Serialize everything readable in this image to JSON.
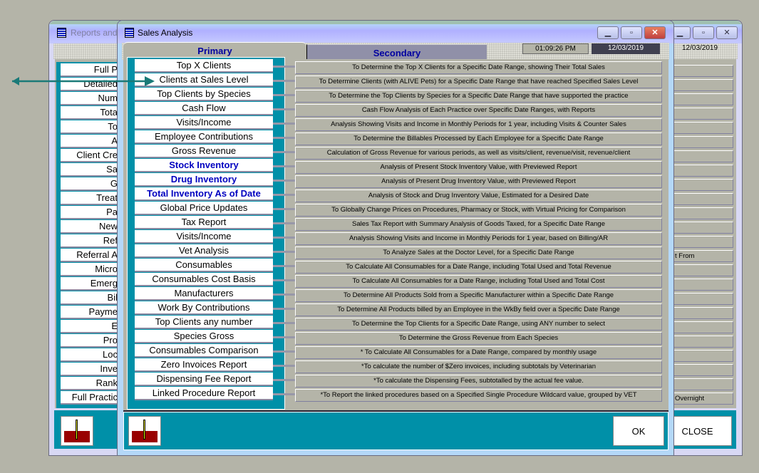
{
  "background_window": {
    "title": "Reports and",
    "date": "12/03/2019",
    "left_items": [
      "Full P",
      "Detailed",
      "Num",
      "Tota",
      "To",
      "A",
      "Client Cre",
      "Sa",
      "G",
      "Treat",
      "Pa",
      "New",
      "Ref",
      "Referral A",
      "Micro",
      "Emerg",
      "Bil",
      "Payme",
      "E",
      "Pro",
      "Loc",
      "Inve",
      "Rank",
      "Full Practic"
    ],
    "right_items": [
      "",
      "",
      "",
      "",
      "",
      "",
      "",
      "",
      "",
      "",
      "",
      "",
      "",
      "t From",
      "",
      "",
      "",
      "",
      "",
      "",
      "",
      "",
      "",
      "Overnight"
    ],
    "close_label": "CLOSE"
  },
  "dialog": {
    "title": "Sales Analysis",
    "tabs": [
      {
        "label": "Primary",
        "active": true
      },
      {
        "label": "Secondary",
        "active": false
      }
    ],
    "time": "01:09:26 PM",
    "date": "12/03/2019",
    "ok_label": "OK",
    "reports": [
      {
        "label": "Top X Clients",
        "desc": "To Determine the Top X Clients for a Specific Date Range, showing Their Total Sales"
      },
      {
        "label": "Clients at Sales Level",
        "desc": "To Determine Clients (with ALIVE Pets) for a Specific Date Range that have reached Specified Sales Level"
      },
      {
        "label": "Top Clients by Species",
        "desc": "To Determine the Top Clients by Species for a Specific Date Range that have supported the practice"
      },
      {
        "label": "Cash Flow",
        "desc": "Cash Flow Analysis of Each Practice over Specific Date Ranges, with Reports"
      },
      {
        "label": "Visits/Income",
        "desc": "Analysis Showing Visits and Income in Monthly Periods for 1 year, including Visits & Counter Sales"
      },
      {
        "label": "Employee Contributions",
        "desc": "To Determine the Billables Processed by Each Employee for a Specific Date Range"
      },
      {
        "label": "Gross Revenue",
        "desc": "Calculation of Gross Revenue for various periods, as well as visits/client, revenue/visit, revenue/client"
      },
      {
        "label": "Stock Inventory",
        "desc": "Analysis of Present Stock Inventory Value, with Previewed Report",
        "bold": true
      },
      {
        "label": "Drug Inventory",
        "desc": "Analysis of Present Drug Inventory Value, with Previewed Report",
        "bold": true
      },
      {
        "label": "Total Inventory As of Date",
        "desc": "Analysis of Stock and Drug Inventory Value, Estimated for a Desired Date",
        "bold": true
      },
      {
        "label": "Global Price Updates",
        "desc": "To Globally Change Prices on Procedures, Pharmacy or Stock, with Virtual Pricing for Comparison"
      },
      {
        "label": "Tax Report",
        "desc": "Sales Tax Report with Summary Analysis of Goods Taxed, for a Specific Date Range"
      },
      {
        "label": "Visits/Income",
        "desc": "Analysis Showing Visits and Income in Monthly Periods for 1 year, based on Billing/AR"
      },
      {
        "label": "Vet Analysis",
        "desc": "To Analyze Sales at the Doctor Level, for a Specific Date Range"
      },
      {
        "label": "Consumables",
        "desc": "To Calculate All Consumables for a Date Range, including Total Used and Total Revenue"
      },
      {
        "label": "Consumables Cost Basis",
        "desc": "To Calculate All Consumables for a Date Range, including Total Used and Total Cost"
      },
      {
        "label": "Manufacturers",
        "desc": "To Determine All Products Sold from a Specific Manufacturer within a Specific Date Range"
      },
      {
        "label": "Work By Contributions",
        "desc": "To Determine All Products billed by an Employee in the WkBy field over a Specific Date Range"
      },
      {
        "label": "Top Clients any number",
        "desc": "To Determine the Top Clients for a Specific Date Range, using ANY number to select"
      },
      {
        "label": "Species Gross",
        "desc": "To Determine the Gross Revenue from Each Species"
      },
      {
        "label": "Consumables Comparison",
        "desc": "* To Calculate All Consumables for a Date Range, compared by monthly usage"
      },
      {
        "label": "Zero Invoices Report",
        "desc": "*To calculate the number of $Zero invoices, including subtotals by Veterinarian"
      },
      {
        "label": "Dispensing Fee Report",
        "desc": "*To calculate the Dispensing Fees, subtotalled by the actual fee value."
      },
      {
        "label": "Linked Procedure Report",
        "desc": "*To Report the linked procedures based on a Specified Single Procedure Wildcard value, grouped by VET"
      }
    ]
  },
  "colors": {
    "teal": "#0090a8",
    "panel": "#b4b4a8",
    "bold_blue": "#0000c0"
  }
}
